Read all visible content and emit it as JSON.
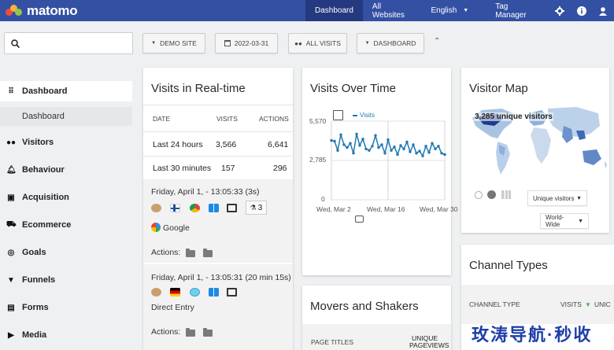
{
  "brand": {
    "name": "matomo"
  },
  "topnav": {
    "items": [
      "Dashboard",
      "All Websites",
      "English",
      "Tag Manager"
    ],
    "icons": [
      "gear-icon",
      "info-icon",
      "user-icon"
    ]
  },
  "filters": {
    "site": "DEMO SITE",
    "date": "2022-03-31",
    "segment": "ALL VISITS",
    "dashboard": "DASHBOARD"
  },
  "sidebar": {
    "items": [
      {
        "label": "Dashboard",
        "icon": "grid-icon"
      },
      {
        "label": "Visitors",
        "icon": "binoculars-icon"
      },
      {
        "label": "Behaviour",
        "icon": "bell-icon"
      },
      {
        "label": "Acquisition",
        "icon": "window-icon"
      },
      {
        "label": "Ecommerce",
        "icon": "cart-icon"
      },
      {
        "label": "Goals",
        "icon": "target-icon"
      },
      {
        "label": "Funnels",
        "icon": "funnel-icon"
      },
      {
        "label": "Forms",
        "icon": "form-icon"
      },
      {
        "label": "Media",
        "icon": "media-icon"
      }
    ],
    "sub": "Dashboard"
  },
  "realtime": {
    "title": "Visits in Real-time",
    "headers": [
      "DATE",
      "VISITS",
      "ACTIONS"
    ],
    "rows": [
      {
        "date": "Last 24 hours",
        "visits": "3,566",
        "actions": "6,641"
      },
      {
        "date": "Last 30 minutes",
        "visits": "157",
        "actions": "296"
      }
    ],
    "visits": [
      {
        "time": "Friday, April 1, - 13:05:33 (3s)",
        "source": "Google",
        "actions_label": "Actions:",
        "count": "3"
      },
      {
        "time": "Friday, April 1, - 13:05:31 (20 min 15s)",
        "source": "Direct Entry",
        "actions_label": "Actions:"
      }
    ]
  },
  "visits_over_time": {
    "title": "Visits Over Time",
    "legend": "Visits",
    "y_ticks": [
      "5,570",
      "2,785",
      "0"
    ],
    "x_ticks": [
      "Wed, Mar 2",
      "Wed, Mar 16",
      "Wed, Mar 30"
    ],
    "color": "#1f78b4"
  },
  "visitor_map": {
    "title": "Visitor Map",
    "label": "3,285 unique visitors",
    "metric_select": "Unique visitors",
    "region_select": "World-Wide"
  },
  "channel_types": {
    "title": "Channel Types",
    "headers": [
      "CHANNEL TYPE",
      "VISITS",
      "UNIC"
    ]
  },
  "movers": {
    "title": "Movers and Shakers",
    "headers": [
      "PAGE TITLES",
      "UNIQUE",
      "PAGEVIEWS"
    ]
  },
  "watermark": "玫涛导航·秒收",
  "chart_data": {
    "type": "line",
    "title": "Visits Over Time",
    "series": [
      {
        "name": "Visits",
        "values": [
          4200,
          4150,
          3500,
          4600,
          3900,
          3700,
          4000,
          3300,
          4650,
          3850,
          4300,
          3600,
          3500,
          3800,
          4550,
          3700,
          3900,
          3300,
          4250,
          3500,
          3750,
          3200,
          3850,
          3600,
          4100,
          3400,
          3900,
          3300,
          3450,
          3100,
          3800,
          3350,
          4000,
          3600,
          3800,
          3300,
          3200
        ]
      }
    ],
    "xlabels": [
      "Wed, Mar 2",
      "Wed, Mar 16",
      "Wed, Mar 30"
    ],
    "ylim": [
      0,
      5570
    ],
    "grid": true
  }
}
